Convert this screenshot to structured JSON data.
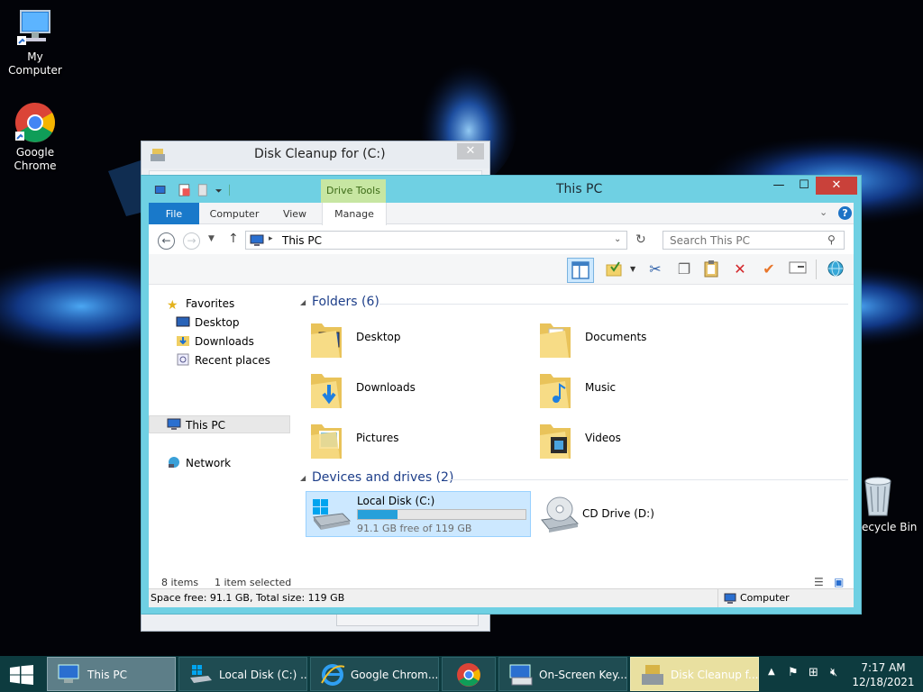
{
  "desktop": {
    "icons": [
      {
        "label": "My Computer"
      },
      {
        "label": "Google Chrome"
      },
      {
        "label": "ecycle Bin"
      }
    ]
  },
  "cleanup_window": {
    "title": "Disk Cleanup for  (C:)",
    "close": "✕"
  },
  "explorer": {
    "title": "This PC",
    "contextual_tab": "Drive Tools",
    "window_buttons": {
      "minimize": "—",
      "maximize": "☐",
      "close": "✕"
    },
    "ribbon_tabs": [
      "File",
      "Computer",
      "View",
      "Manage"
    ],
    "help": "?",
    "address": {
      "path": "This PC"
    },
    "search": {
      "placeholder": "Search This PC"
    },
    "nav": {
      "favorites": "Favorites",
      "favorite_items": [
        "Desktop",
        "Downloads",
        "Recent places"
      ],
      "this_pc": "This PC",
      "network": "Network"
    },
    "folders_group": "Folders (6)",
    "folders": [
      "Desktop",
      "Documents",
      "Downloads",
      "Music",
      "Pictures",
      "Videos"
    ],
    "devices_group": "Devices and drives (2)",
    "drives": {
      "local": {
        "name": "Local Disk (C:)",
        "free_text": "91.1 GB free of 119 GB",
        "used_fraction": 0.234
      },
      "cd": {
        "name": "CD Drive (D:)"
      }
    },
    "status": {
      "items": "8 items",
      "selected": "1 item selected"
    },
    "details": {
      "space": "Space free: 91.1 GB, Total size: 119 GB",
      "location": "Computer"
    },
    "colors": {
      "accent": "#1979ca",
      "frame": "#6fd0e3",
      "selection": "#cce8ff",
      "group_heading": "#1e3f8a"
    }
  },
  "taskbar": {
    "items": [
      "This PC",
      "Local Disk (C:) ...",
      "Google Chrom...",
      "On-Screen Key...",
      "Disk Cleanup f..."
    ],
    "clock": {
      "time": "7:17 AM",
      "date": "12/18/2021"
    }
  }
}
